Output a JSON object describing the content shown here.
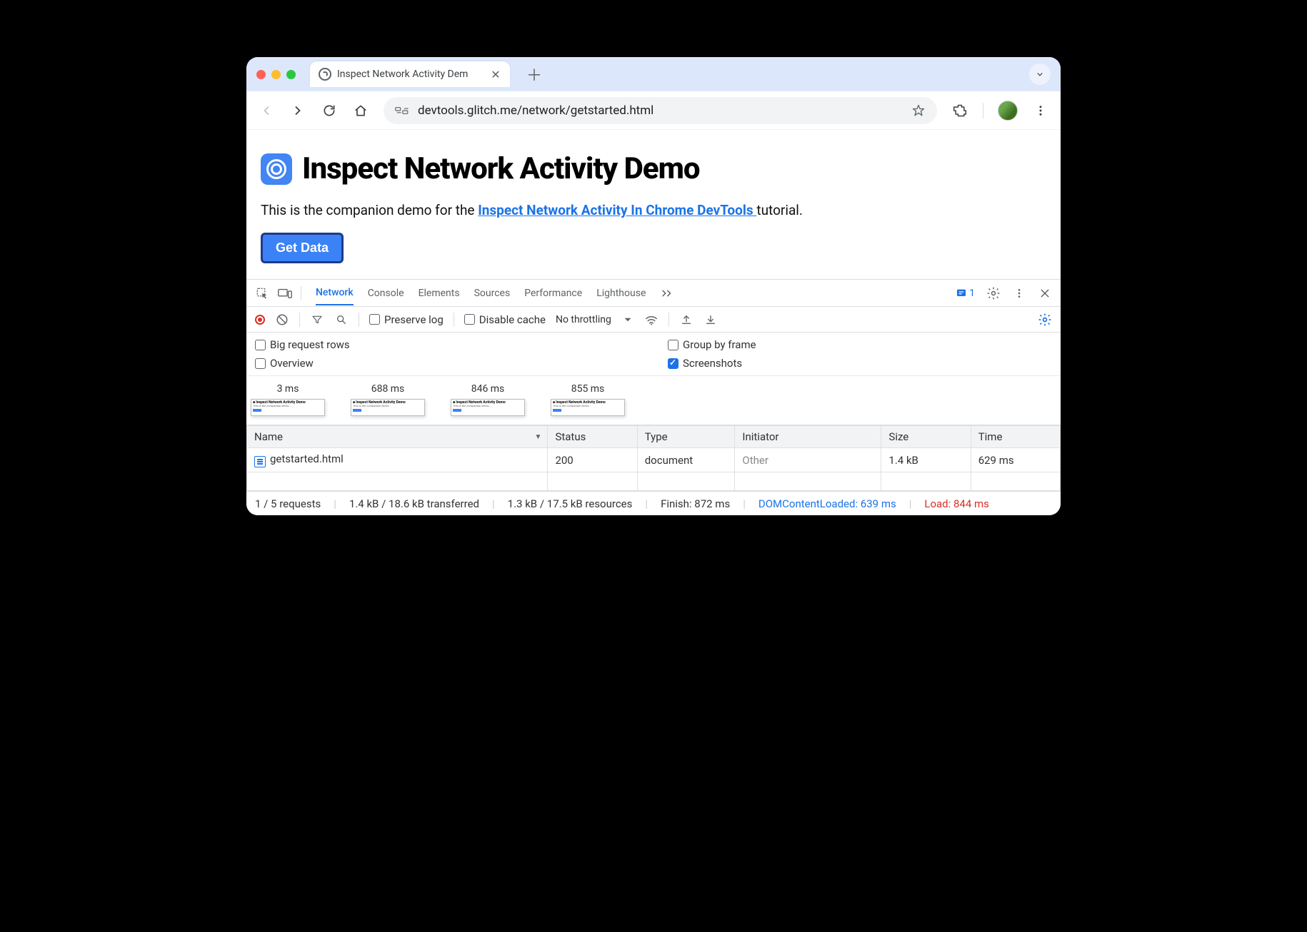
{
  "browser": {
    "tab_title": "Inspect Network Activity Dem",
    "url": "devtools.glitch.me/network/getstarted.html"
  },
  "page": {
    "title": "Inspect Network Activity Demo",
    "desc_prefix": "This is the companion demo for the ",
    "link_text": "Inspect Network Activity In Chrome DevTools ",
    "desc_suffix": "tutorial.",
    "button": "Get Data"
  },
  "devtools": {
    "tabs": [
      "Network",
      "Console",
      "Elements",
      "Sources",
      "Performance",
      "Lighthouse"
    ],
    "active_tab": "Network",
    "badge_count": "1",
    "filters": {
      "preserve_log": "Preserve log",
      "disable_cache": "Disable cache",
      "throttling": "No throttling"
    },
    "options": {
      "big_rows": "Big request rows",
      "group_frame": "Group by frame",
      "overview": "Overview",
      "screenshots": "Screenshots"
    },
    "filmstrip": [
      "3 ms",
      "688 ms",
      "846 ms",
      "855 ms"
    ],
    "columns": [
      "Name",
      "Status",
      "Type",
      "Initiator",
      "Size",
      "Time"
    ],
    "rows": [
      {
        "name": "getstarted.html",
        "status": "200",
        "type": "document",
        "initiator": "Other",
        "size": "1.4 kB",
        "time": "629 ms"
      }
    ],
    "status": {
      "requests": "1 / 5 requests",
      "transferred": "1.4 kB / 18.6 kB transferred",
      "resources": "1.3 kB / 17.5 kB resources",
      "finish": "Finish: 872 ms",
      "dcl": "DOMContentLoaded: 639 ms",
      "load": "Load: 844 ms"
    }
  }
}
